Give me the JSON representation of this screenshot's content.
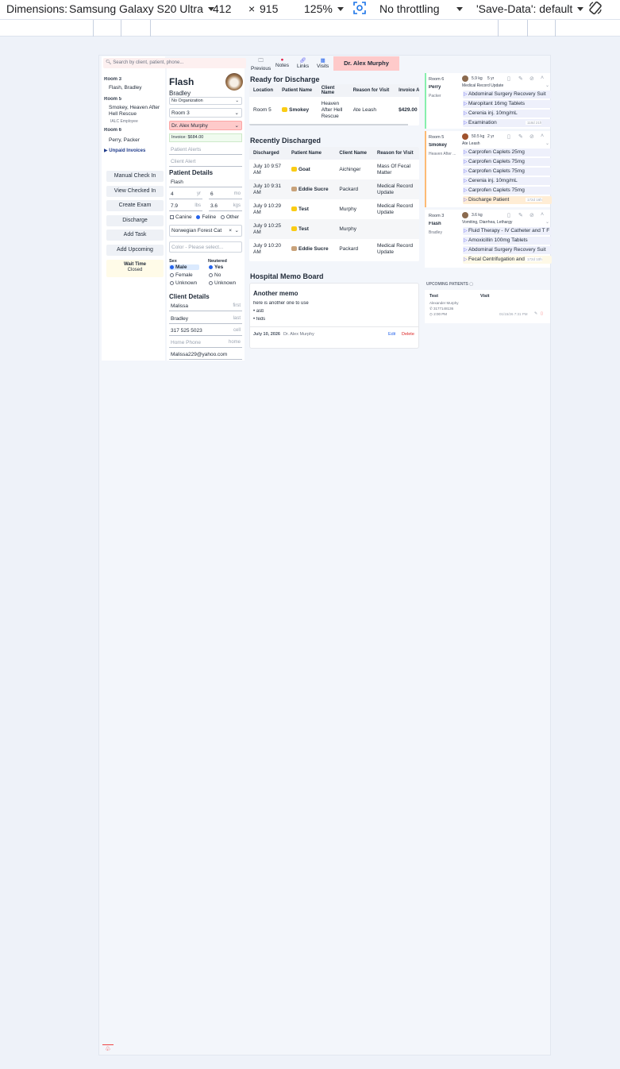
{
  "devtools": {
    "dimensions_label": "Dimensions:",
    "device": "Samsung Galaxy S20 Ultra",
    "width": "412",
    "times": "×",
    "height": "915",
    "zoom": "125%",
    "throttling": "No throttling",
    "save_data": "'Save-Data': default"
  },
  "left_sidebar": {
    "search_placeholder": "Search by client, patient, phone...",
    "rooms": [
      {
        "room": "Room 3",
        "patient": "Flash, Bradley",
        "note": ""
      },
      {
        "room": "Room 5",
        "patient": "Smokey, Heaven After Hell Rescue",
        "note": "IALC Employee"
      },
      {
        "room": "Room 6",
        "patient": "Perry, Packer",
        "note": ""
      }
    ],
    "unpaid_invoices": "Unpaid Invoices",
    "buttons": [
      "Manual Check In",
      "View Checked In",
      "Create Exam",
      "Discharge",
      "Add Task",
      "Add Upcoming"
    ],
    "wait_time_label": "Wait Time",
    "wait_time_value": "Closed"
  },
  "patient_panel": {
    "name": "Flash",
    "client": "Bradley",
    "organization": "No Organization",
    "room": "Room 3",
    "doctor": "Dr. Alex Murphy",
    "invoice": "Invoice: $684.00",
    "patient_alerts_placeholder": "Patient Alerts",
    "client_alert_placeholder": "Client Alert",
    "details_heading": "Patient Details",
    "patient_name": "Flash",
    "age_yr": "4",
    "age_yr_unit": "yr",
    "age_mo": "6",
    "age_mo_unit": "mo",
    "weight_lbs": "7.9",
    "lbs_unit": "lbs",
    "weight_kgs": "3.6",
    "kgs_unit": "kgs",
    "species": [
      "Canine",
      "Feline",
      "Other"
    ],
    "species_selected": "Feline",
    "breed": "Norwegian Forest Cat",
    "color_placeholder": "Color - Please select...",
    "sex_label": "Sex",
    "sex_options": [
      "Male",
      "Female",
      "Unknown"
    ],
    "neutered_label": "Neutered",
    "neutered_options": [
      "Yes",
      "No",
      "Unknown"
    ],
    "client_heading": "Client Details",
    "first_name": "Malissa",
    "first_hint": "first",
    "last_name": "Bradley",
    "last_hint": "last",
    "cell": "317 525 5023",
    "cell_hint": "cell",
    "home_phone_placeholder": "Home Phone",
    "home_hint": "home",
    "email": "Malissa229@yahoo.com"
  },
  "top_nav": {
    "previous": "Previous",
    "notes": "Notes",
    "links": "Links",
    "visits": "Visits",
    "doctor_tab": "Dr. Alex Murphy"
  },
  "ready_for_discharge": {
    "title": "Ready for Discharge",
    "headers": [
      "Location",
      "Patient Name",
      "Client Name",
      "Reason for Visit",
      "Invoice Amo"
    ],
    "rows": [
      {
        "location": "Room 5",
        "patient": "Smokey",
        "client": "Heaven After Hell Rescue",
        "reason": "Ate Leash",
        "invoice": "$429.00"
      }
    ]
  },
  "recently_discharged": {
    "title": "Recently Discharged",
    "headers": [
      "Discharged",
      "Patient Name",
      "Client Name",
      "Reason for Visit"
    ],
    "rows": [
      {
        "time": "July 10 9:57 AM",
        "patient": "Goat",
        "client": "Aichinger",
        "reason": "Mass Of Fecal Matter",
        "pet": "dog"
      },
      {
        "time": "July 10 9:31 AM",
        "patient": "Eddie Sucre",
        "client": "Packard",
        "reason": "Medical Record Update",
        "pet": "cat"
      },
      {
        "time": "July 9 10:29 AM",
        "patient": "Test",
        "client": "Murphy",
        "reason": "Medical Record Update",
        "pet": "dog"
      },
      {
        "time": "July 9 10:25 AM",
        "patient": "Test",
        "client": "Murphy",
        "reason": "",
        "pet": "dog"
      },
      {
        "time": "July 9 10:20 AM",
        "patient": "Eddie Sucre",
        "client": "Packard",
        "reason": "Medical Record Update",
        "pet": "cat"
      }
    ]
  },
  "memo_board": {
    "title": "Hospital Memo Board",
    "memo_title": "Another memo",
    "memo_body": "here is another one to use",
    "bullets": [
      "asb",
      "feds"
    ],
    "date": "July 10, 2026",
    "author": "Dr. Alex Murphy",
    "edit": "Edit",
    "delete": "Delete"
  },
  "room_cards": [
    {
      "room": "Room 6",
      "patient": "Perry",
      "client": "Packer",
      "weight": "5.9 kg",
      "age": "5 yr",
      "reason": "Medical Record Update",
      "orders": [
        "Abdominal Surgery Recovery Suit",
        "Maropitant 16mg Tablets",
        "Cerenia inj. 10mg/mL",
        "Examination"
      ],
      "elapsed": "118d 21h",
      "accent": "#86efac"
    },
    {
      "room": "Room 5",
      "patient": "Smokey",
      "client": "Heaven After ...",
      "weight": "50.5 kg",
      "age": "2 yr",
      "reason": "Ate Leash",
      "orders": [
        "Carprofen Caplets 25mg",
        "Carprofen Caplets 75mg",
        "Carprofen Caplets 75mg",
        "Cerenia inj. 10mg/mL",
        "Carprofen Caplets 75mg",
        "Discharge Patient"
      ],
      "elapsed": "172d 16h",
      "accent": "#fdba74"
    },
    {
      "room": "Room 3",
      "patient": "Flash",
      "client": "Bradley",
      "weight": "3.6 kg",
      "age": "",
      "reason": "Vomiting, Diarrhea, Lethargy",
      "orders": [
        "Fluid Therapy - IV Catheter and T F",
        "Amoxicillin 100mg Tablets",
        "Abdominal Surgery Recovery Suit",
        "Fecal Centrifugation and"
      ],
      "elapsed": "172d 10h",
      "accent": "#ffffff"
    }
  ],
  "upcoming": {
    "title": "UPCOMING PATIENTS",
    "col_test": "Test",
    "col_visit": "Visit",
    "name": "Alexander Murphy",
    "phone": "3177148136",
    "time": "2:00 PM",
    "date": "01/15/26 7:31 PM"
  },
  "colors": {
    "accent": "#2563eb",
    "doctor_tab_bg": "#fecaca",
    "delete": "#dc2626"
  }
}
